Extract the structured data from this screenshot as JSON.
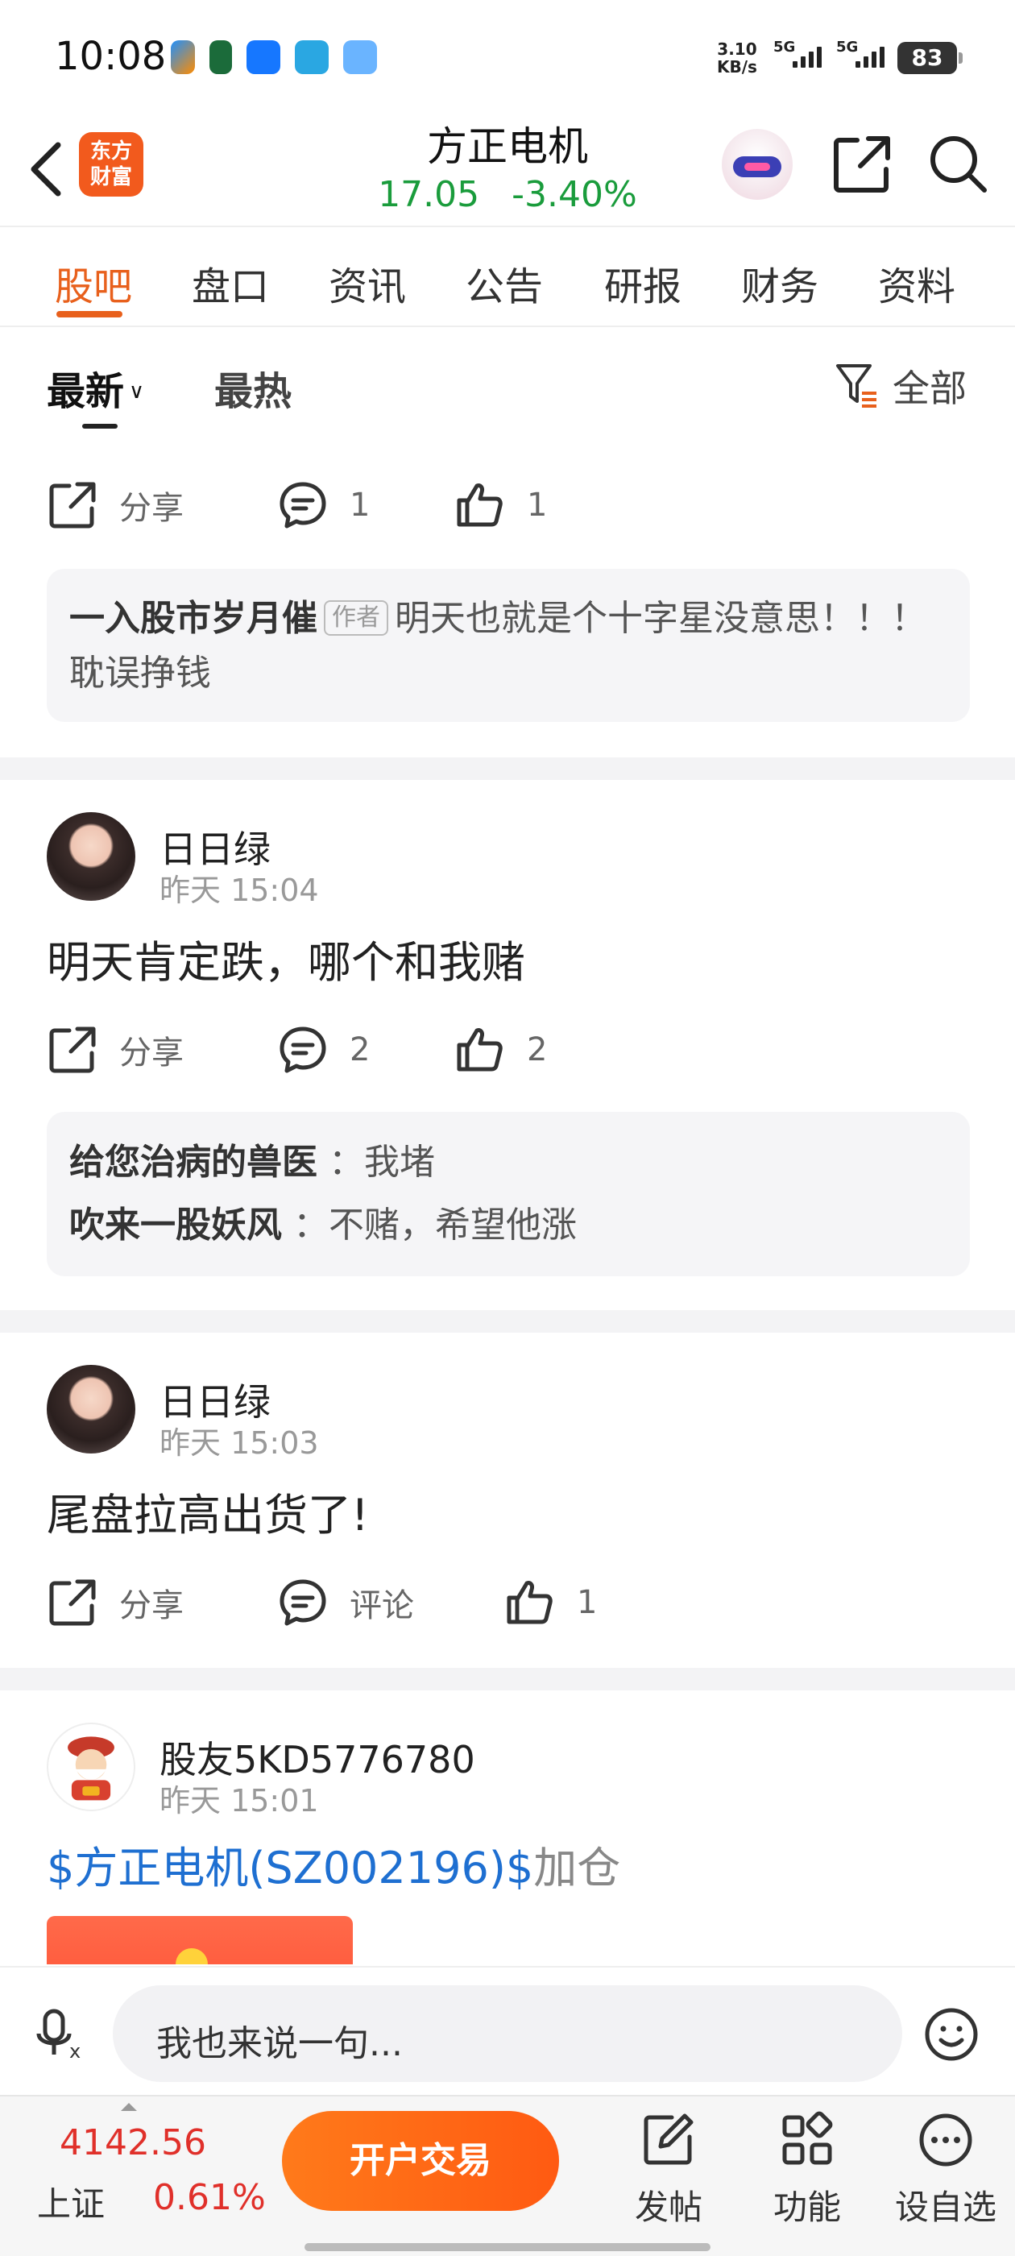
{
  "status_bar": {
    "time": "10:08",
    "net_speed_value": "3.10",
    "net_speed_unit": "KB/s",
    "sig1": "5G",
    "sig2": "5G",
    "battery": "83"
  },
  "header": {
    "logo_line1": "东方",
    "logo_line2": "财富",
    "stock_name": "方正电机",
    "price": "17.05",
    "change": "-3.40%",
    "price_color": "#1a9c3c"
  },
  "tabs": [
    "股吧",
    "盘口",
    "资讯",
    "公告",
    "研报",
    "财务",
    "资料"
  ],
  "filter": {
    "sort_new": "最新",
    "sort_hot": "最热",
    "filter_all": "全部"
  },
  "labels": {
    "share": "分享",
    "comment": "评论"
  },
  "post0": {
    "comments_count": "1",
    "likes_count": "1",
    "comment": {
      "user": "一入股市岁月催",
      "tag": "作者",
      "text": "明天也就是个十字星没意思！！！ 耽误挣钱"
    }
  },
  "post1": {
    "user": "日日绿",
    "time": "昨天 15:04",
    "text": "明天肯定跌，哪个和我赌",
    "comments_count": "2",
    "likes_count": "2",
    "comments": [
      {
        "user": "给您治病的兽医",
        "text": "：我堵"
      },
      {
        "user": "吹来一股妖风",
        "text": "：不赌，希望他涨"
      }
    ]
  },
  "post2": {
    "user": "日日绿",
    "time": "昨天 15:03",
    "text": "尾盘拉高出货了!",
    "likes_count": "1"
  },
  "post3": {
    "user": "股友5KD5776780",
    "time": "昨天 15:01",
    "link": "$方正电机(SZ002196)$",
    "text": "加仓"
  },
  "input": {
    "placeholder": "我也来说一句..."
  },
  "bottom": {
    "index_value": "4142.56",
    "index_name": "上证",
    "index_pct": "0.61%",
    "trade_button": "开户交易",
    "post": "发帖",
    "functions": "功能",
    "watchlist": "设自选",
    "up_color": "#e0302a"
  }
}
